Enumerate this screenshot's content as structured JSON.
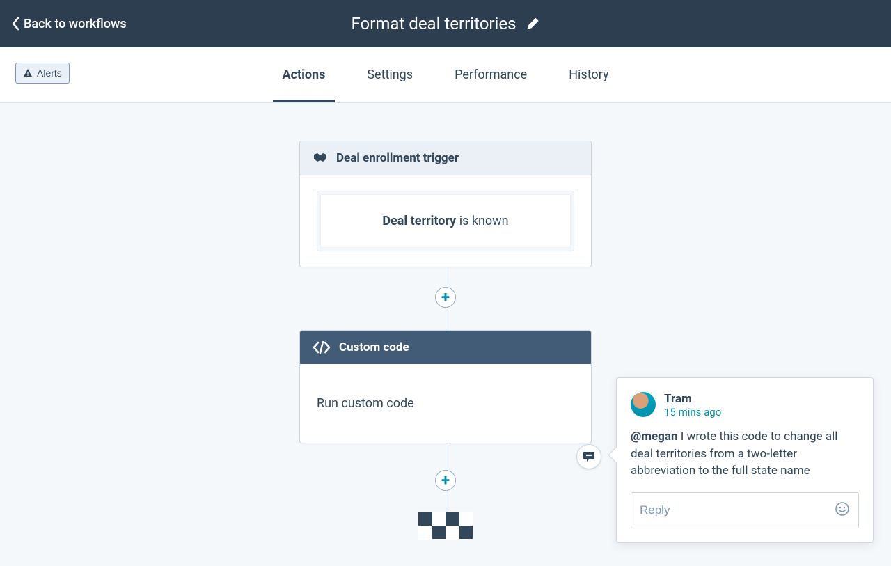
{
  "header": {
    "back_label": "Back to workflows",
    "title": "Format deal territories"
  },
  "toolbar": {
    "alerts_label": "Alerts",
    "tabs": [
      {
        "label": "Actions",
        "active": true
      },
      {
        "label": "Settings",
        "active": false
      },
      {
        "label": "Performance",
        "active": false
      },
      {
        "label": "History",
        "active": false
      }
    ]
  },
  "flow": {
    "trigger": {
      "title": "Deal enrollment trigger",
      "condition_strong": "Deal territory",
      "condition_rest": " is known"
    },
    "action": {
      "title": "Custom code",
      "body": "Run custom code"
    }
  },
  "comment": {
    "author": "Tram",
    "time": "15 mins ago",
    "mention": "@megan",
    "body_rest": " I wrote this code to change all deal territories from a two-letter abbreviation to the full state name",
    "reply_placeholder": "Reply"
  }
}
